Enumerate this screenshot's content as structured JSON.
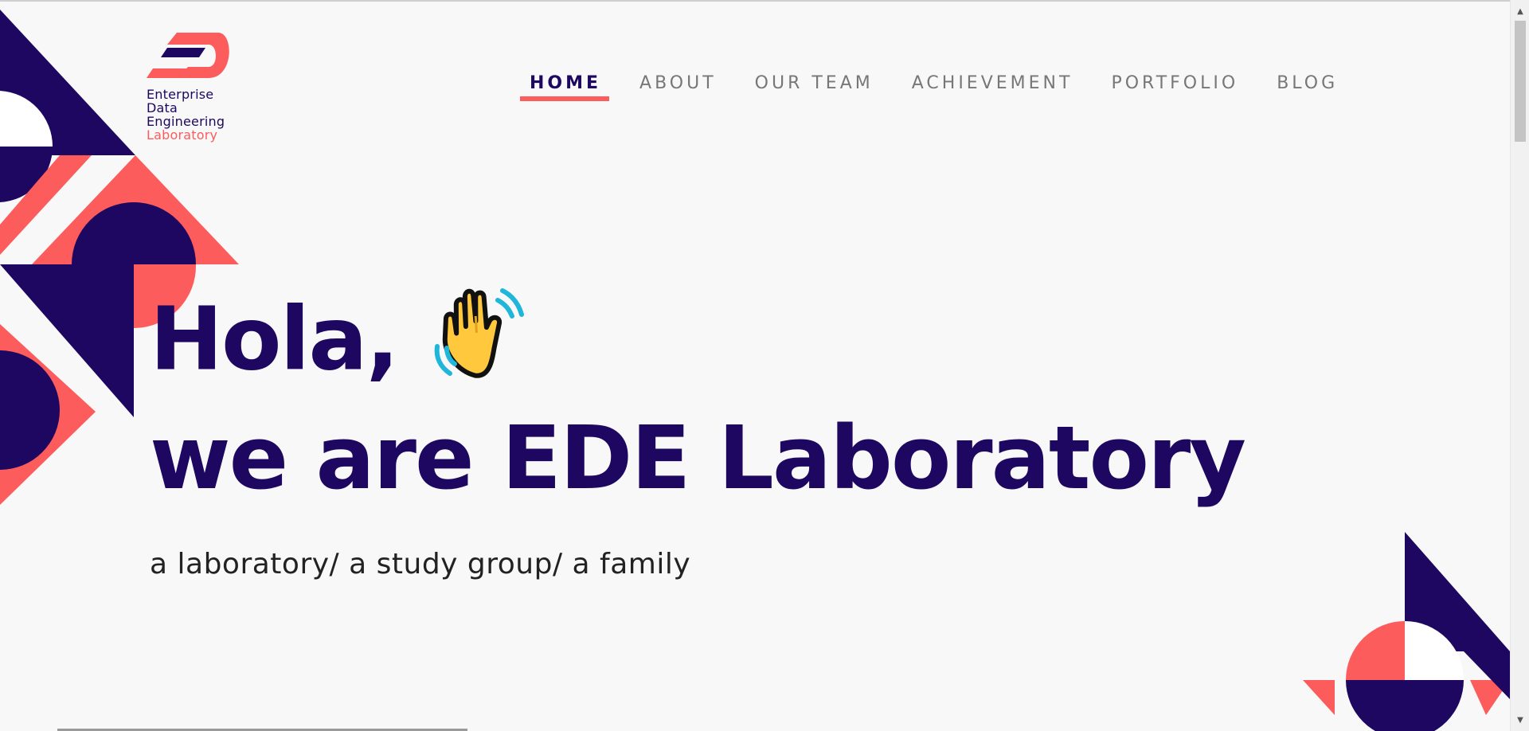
{
  "brand": {
    "logo_lines": [
      "Enterprise",
      "Data",
      "Engineering",
      "Laboratory"
    ],
    "primary_color": "#1e0760",
    "accent_color": "#fc5c5c"
  },
  "nav": {
    "items": [
      {
        "label": "HOME",
        "active": true
      },
      {
        "label": "ABOUT",
        "active": false
      },
      {
        "label": "OUR TEAM",
        "active": false
      },
      {
        "label": "ACHIEVEMENT",
        "active": false
      },
      {
        "label": "PORTFOLIO",
        "active": false
      },
      {
        "label": "BLOG",
        "active": false
      }
    ]
  },
  "hero": {
    "line1": "Hola,",
    "line2": "we are EDE Laboratory",
    "wave_icon": "waving-hand-icon",
    "tagline": "a laboratory/ a study group/ a family"
  }
}
